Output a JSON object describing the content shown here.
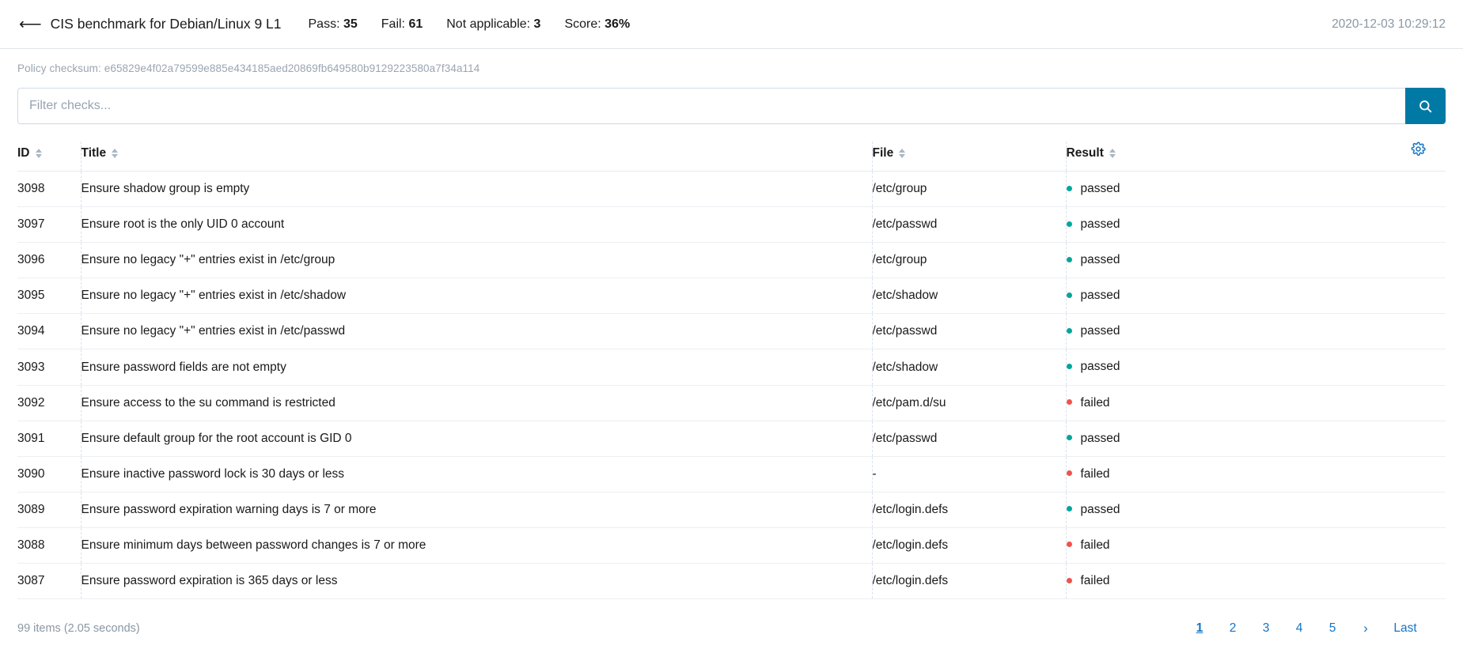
{
  "header": {
    "back_icon": "arrow-left-icon",
    "benchmark_title": "CIS benchmark for Debian/Linux 9 L1",
    "stats": [
      {
        "label": "Pass:",
        "value": "35"
      },
      {
        "label": "Fail:",
        "value": "61"
      },
      {
        "label": "Not applicable:",
        "value": "3"
      },
      {
        "label": "Score:",
        "value": "36%"
      }
    ],
    "timestamp": "2020-12-03 10:29:12"
  },
  "checksum": {
    "text": "Policy checksum: e65829e4f02a79599e885e434185aed20869fb649580b9129223580a7f34a114"
  },
  "filter": {
    "placeholder": "Filter checks...",
    "value": "",
    "search_icon": "search-icon",
    "button_color": "#0079a5"
  },
  "table": {
    "columns": [
      {
        "key": "id",
        "label": "ID"
      },
      {
        "key": "title",
        "label": "Title"
      },
      {
        "key": "file",
        "label": "File"
      },
      {
        "key": "result",
        "label": "Result"
      }
    ],
    "settings_icon": "gear-icon",
    "status_colors": {
      "passed": "#00a69c",
      "failed": "#f0524d"
    },
    "rows": [
      {
        "id": "3098",
        "title": "Ensure shadow group is empty",
        "file": "/etc/group",
        "result": "passed"
      },
      {
        "id": "3097",
        "title": "Ensure root is the only UID 0 account",
        "file": "/etc/passwd",
        "result": "passed"
      },
      {
        "id": "3096",
        "title": "Ensure no legacy \"+\" entries exist in /etc/group",
        "file": "/etc/group",
        "result": "passed"
      },
      {
        "id": "3095",
        "title": "Ensure no legacy \"+\" entries exist in /etc/shadow",
        "file": "/etc/shadow",
        "result": "passed"
      },
      {
        "id": "3094",
        "title": "Ensure no legacy \"+\" entries exist in /etc/passwd",
        "file": "/etc/passwd",
        "result": "passed"
      },
      {
        "id": "3093",
        "title": "Ensure password fields are not empty",
        "file": "/etc/shadow",
        "result": "passed"
      },
      {
        "id": "3092",
        "title": "Ensure access to the su command is restricted",
        "file": "/etc/pam.d/su",
        "result": "failed"
      },
      {
        "id": "3091",
        "title": "Ensure default group for the root account is GID 0",
        "file": "/etc/passwd",
        "result": "passed"
      },
      {
        "id": "3090",
        "title": "Ensure inactive password lock is 30 days or less",
        "file": "-",
        "result": "failed"
      },
      {
        "id": "3089",
        "title": "Ensure password expiration warning days is 7 or more",
        "file": "/etc/login.defs",
        "result": "passed"
      },
      {
        "id": "3088",
        "title": "Ensure minimum days between password changes is 7 or more",
        "file": "/etc/login.defs",
        "result": "failed"
      },
      {
        "id": "3087",
        "title": "Ensure password expiration is 365 days or less",
        "file": "/etc/login.defs",
        "result": "failed"
      }
    ]
  },
  "footer": {
    "items_count": "99 items (2.05 seconds)",
    "pages": [
      {
        "label": "1",
        "active": true
      },
      {
        "label": "2",
        "active": false
      },
      {
        "label": "3",
        "active": false
      },
      {
        "label": "4",
        "active": false
      },
      {
        "label": "5",
        "active": false
      }
    ],
    "next_label": "›",
    "last_label": "Last"
  }
}
